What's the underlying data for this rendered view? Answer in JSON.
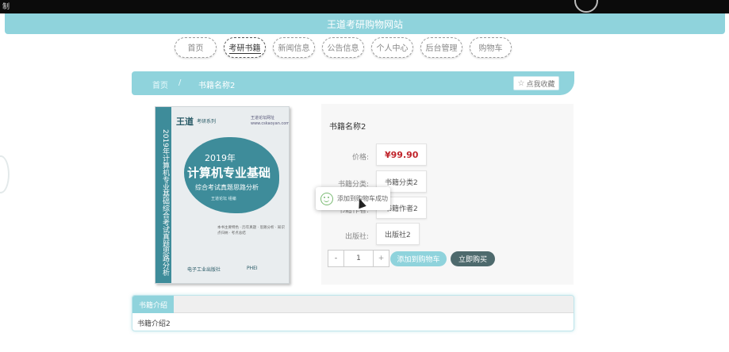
{
  "window": {
    "corner_text": "制"
  },
  "header": {
    "title": "王道考研购物网站"
  },
  "nav": {
    "items": [
      {
        "label": "首页",
        "active": false
      },
      {
        "label": "考研书籍",
        "active": true
      },
      {
        "label": "新闻信息",
        "active": false
      },
      {
        "label": "公告信息",
        "active": false
      },
      {
        "label": "个人中心",
        "active": false
      },
      {
        "label": "后台管理",
        "active": false
      },
      {
        "label": "购物车",
        "active": false
      }
    ]
  },
  "breadcrumb": {
    "home": "首页",
    "separator": "/",
    "current": "书籍名称2"
  },
  "favorite": {
    "label": "点我收藏",
    "icon": "star-icon"
  },
  "book_cover": {
    "brand": "王道",
    "series": "考研系列",
    "top_info": "王道论坛网址 www.cskaoyan.com",
    "spine": "2019年计算机专业基础综合考试真题思路分析",
    "year": "2019年",
    "title": "计算机专业基础",
    "subtitle": "综合考试真题思路分析",
    "author": "王道论坛 组编",
    "bullets": "本书主要特色 · 历年真题 · 思路分析 · 知识点归纳 · 考点总结",
    "publisher": "电子工业出版社",
    "publisher_logo": "PHEI"
  },
  "product": {
    "title": "书籍名称2",
    "price_label": "价格:",
    "price": "¥99.90",
    "category_label": "书籍分类:",
    "category": "书籍分类2",
    "author_label": "书籍作者:",
    "author": "书籍作者2",
    "publisher_label": "出版社:",
    "publisher": "出版社2",
    "quantity": "1",
    "minus": "-",
    "plus": "+",
    "add_cart": "添加到购物车",
    "buy_now": "立即购买"
  },
  "toast": {
    "message": "添加到购物车成功",
    "icon": "smile-icon"
  },
  "description": {
    "tab": "书籍介绍",
    "content": "书籍介绍2"
  },
  "colors": {
    "accent": "#8fd3dc",
    "price": "#c0242b",
    "buy": "#4e6a6d"
  }
}
